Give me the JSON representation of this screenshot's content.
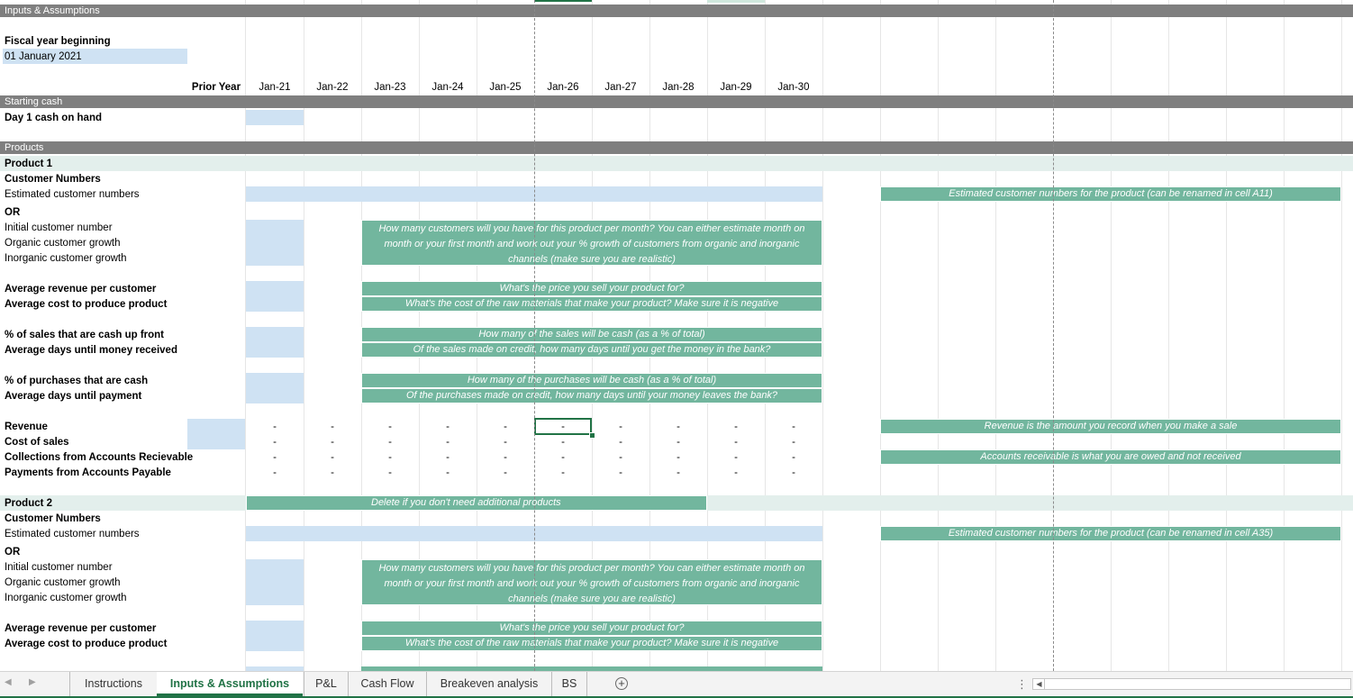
{
  "sheet": {
    "section_title": "Inputs & Assumptions",
    "fiscal_label": "Fiscal year beginning",
    "fiscal_value": "01 January 2021",
    "headers": [
      "Prior Year",
      "Jan-21",
      "Jan-22",
      "Jan-23",
      "Jan-24",
      "Jan-25",
      "Jan-26",
      "Jan-27",
      "Jan-28",
      "Jan-29",
      "Jan-30"
    ],
    "starting_cash": {
      "band": "Starting cash",
      "label": "Day 1 cash on hand"
    },
    "products_band": "Products",
    "dash": "-",
    "product1": {
      "title": "Product 1",
      "customer_numbers": "Customer Numbers",
      "estimated": "Estimated customer numbers",
      "or": "OR",
      "initial": "Initial customer number",
      "organic": "Organic customer growth",
      "inorganic": "Inorganic customer growth",
      "arpc": "Average revenue per customer",
      "cost": "Average cost to produce product",
      "cash_up_front": "% of sales that are cash up front",
      "days_money": "Average days until money received",
      "purch_cash": "% of purchases that are cash",
      "days_payment": "Average days until payment",
      "revenue": "Revenue",
      "cost_of_sales": "Cost of sales",
      "collections": "Collections from Accounts Recievable",
      "payments": "Payments from Accounts Payable",
      "note_estimated": "Estimated customer numbers for the product (can be renamed in cell A11)",
      "note_customers": "How many customers will you have for this product per month? You can either estimate month on month or your first month and work out your % growth of customers from organic and inorganic channels (make sure you are realistic)",
      "note_price": "What's the price you sell your product for?",
      "note_cost": "What's the cost of the raw materials that make your product? Make sure it is negative",
      "note_sales_cash": "How many of the sales will be cash (as a % of total)",
      "note_sales_credit": "Of the sales made on credit, how many days until you get the money in the bank?",
      "note_purch_cash": "How many of the purchases will be cash (as a % of total)",
      "note_purch_credit": "Of the purchases made on credit, how many days until your money leaves the bank?",
      "note_revenue": "Revenue is the amount you record when you make a sale",
      "note_ar": "Accounts receivable is what you are owed and not received"
    },
    "product2": {
      "title": "Product 2",
      "delete_note": "Delete if you don't need additional products",
      "customer_numbers": "Customer Numbers",
      "estimated": "Estimated customer numbers",
      "or": "OR",
      "initial": "Initial customer number",
      "organic": "Organic customer growth",
      "inorganic": "Inorganic customer growth",
      "arpc": "Average revenue per customer",
      "cost": "Average cost to produce product",
      "note_estimated": "Estimated customer numbers for the product (can be renamed in cell A35)",
      "note_customers": "How many customers will you have for this product per month? You can either estimate month on month or your first month and work out your % growth of customers from organic and inorganic channels (make sure you are realistic)",
      "note_price": "What's the price you sell your product for?",
      "note_cost": "What's the cost of the raw materials that make your product? Make sure it is negative"
    }
  },
  "tabs": [
    "Instructions",
    "Inputs & Assumptions",
    "P&L",
    "Cash Flow",
    "Breakeven analysis",
    "BS"
  ],
  "active_tab": "Inputs & Assumptions",
  "colors": {
    "band": "#7f7f7f",
    "input": "#cfe2f3",
    "note": "#72b69e",
    "accent": "#217346",
    "product_band": "#e3efec"
  }
}
